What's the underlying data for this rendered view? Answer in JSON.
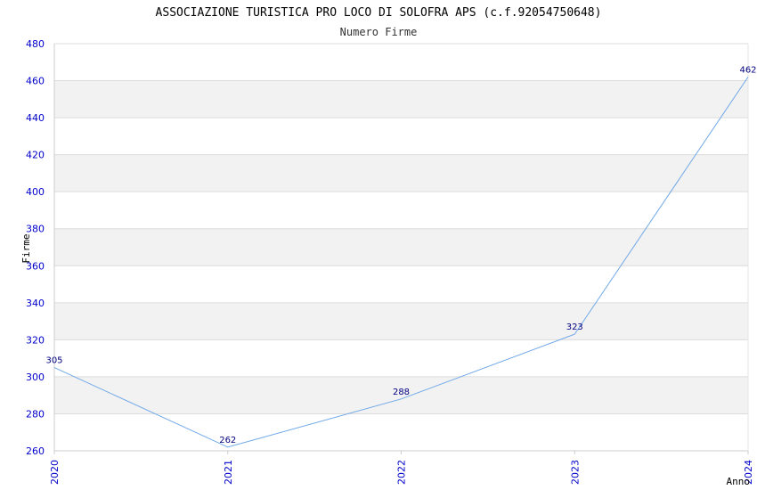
{
  "chart_data": {
    "type": "line",
    "title": "ASSOCIAZIONE TURISTICA PRO LOCO DI SOLOFRA APS (c.f.92054750648)",
    "subtitle": "Numero Firme",
    "xlabel": "Anno",
    "ylabel": "Firme",
    "x": [
      "2020",
      "2021",
      "2022",
      "2023",
      "2024"
    ],
    "series": [
      {
        "values": [
          305,
          262,
          288,
          323,
          462
        ]
      }
    ],
    "ylim": [
      260,
      480
    ],
    "yticks": [
      260,
      280,
      300,
      320,
      340,
      360,
      380,
      400,
      420,
      440,
      460,
      480
    ],
    "grid": true,
    "colors": {
      "line": "#6fa8e8",
      "band": "#f2f2f2",
      "grid": "#dcdcdc",
      "tick_text": "#0000cc",
      "data_label": "#000080"
    }
  }
}
